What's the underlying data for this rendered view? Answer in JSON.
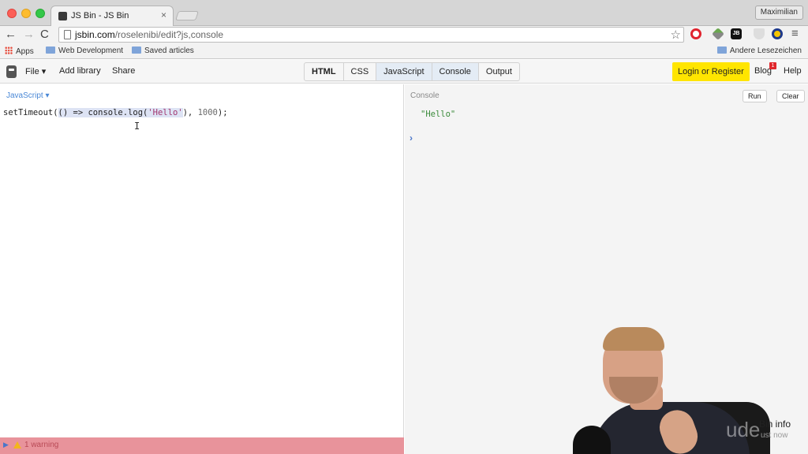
{
  "browser": {
    "tab_title": "JS Bin - JS Bin",
    "tab_close": "×",
    "profile_name": "Maximilian",
    "url_host": "jsbin.com",
    "url_path": "/roselenibi/edit?js,console",
    "nav": {
      "back": "←",
      "forward": "→",
      "reload": "C"
    },
    "star": "☆",
    "ext_jb": "JB",
    "menu": "≡",
    "bookmarks": {
      "apps": "Apps",
      "items": [
        "Web Development",
        "Saved articles"
      ],
      "other": "Andere Lesezeichen"
    }
  },
  "jsbin": {
    "menu": {
      "file": "File ▾",
      "add_library": "Add library",
      "share": "Share"
    },
    "panels": [
      "HTML",
      "CSS",
      "JavaScript",
      "Console",
      "Output"
    ],
    "login": "Login or Register",
    "blog": "Blog",
    "blog_badge": "1",
    "help": "Help"
  },
  "editor": {
    "language": "JavaScript ▾",
    "code": {
      "prefix": "setTimeout(",
      "hl_a": "() => console.log(",
      "hl_str": "'Hello'",
      "suffix_a": "), ",
      "num": "1000",
      "suffix_b": ");"
    },
    "cursor": "I",
    "warning": {
      "arrow": "▶",
      "text": "1 warning"
    }
  },
  "console": {
    "title": "Console",
    "run": "Run",
    "clear": "Clear",
    "output": "\"Hello\"",
    "prompt": "›"
  },
  "overlay": {
    "watermark": "ude",
    "bin_info": "Bin info",
    "bin_info_sub": "ust now"
  },
  "colors": {
    "login_bg": "#ffe500",
    "warning_bar": "#e8939b",
    "console_output": "#3a8a3a",
    "link_blue": "#4a88d6"
  }
}
